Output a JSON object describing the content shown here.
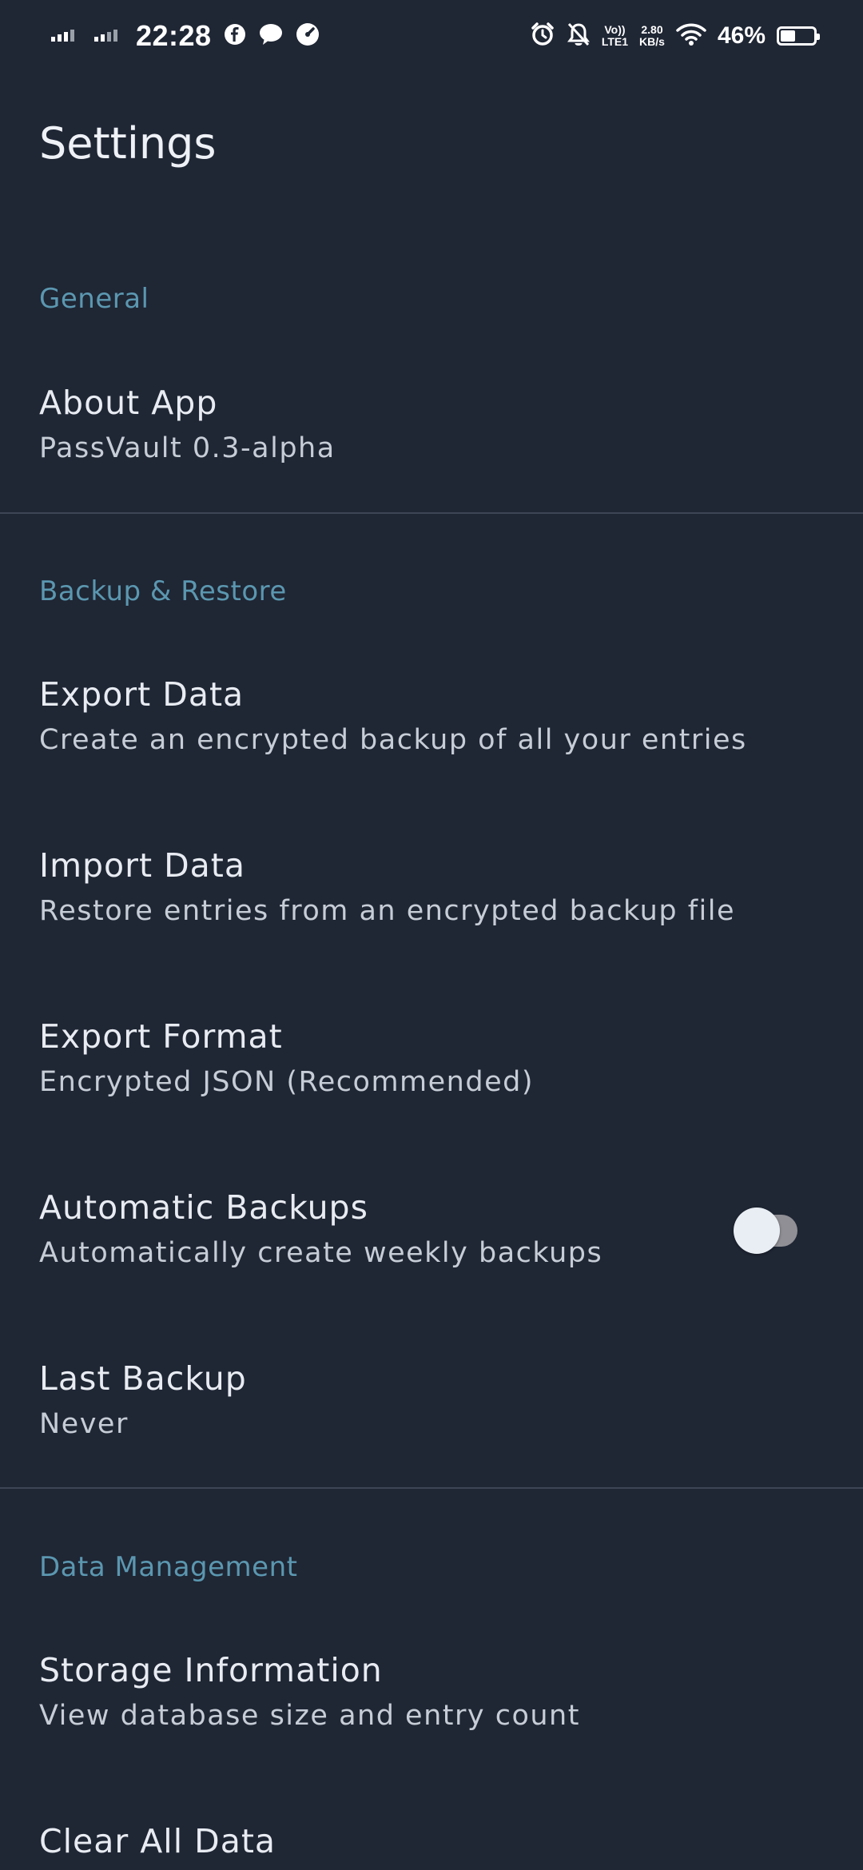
{
  "status_bar": {
    "time": "22:28",
    "net_speed_value": "2.80",
    "net_speed_unit": "KB/s",
    "volte_top": "Vo))",
    "volte_bottom": "LTE1",
    "battery": "46%",
    "battery_level": 0.46,
    "icons": [
      "signal-icon",
      "signal-icon",
      "facebook-icon",
      "messenger-icon",
      "speedometer-icon",
      "alarm-icon",
      "bell-off-icon",
      "wifi-icon",
      "battery-icon"
    ]
  },
  "page": {
    "title": "Settings"
  },
  "sections": {
    "general": {
      "header": "General",
      "about": {
        "title": "About App",
        "subtitle": "PassVault 0.3-alpha"
      }
    },
    "backup": {
      "header": "Backup & Restore",
      "export": {
        "title": "Export Data",
        "subtitle": "Create an encrypted backup of all your entries"
      },
      "import": {
        "title": "Import Data",
        "subtitle": "Restore entries from an encrypted backup file"
      },
      "format": {
        "title": "Export Format",
        "subtitle": "Encrypted JSON (Recommended)"
      },
      "auto": {
        "title": "Automatic Backups",
        "subtitle": "Automatically create weekly backups",
        "enabled": false
      },
      "last": {
        "title": "Last Backup",
        "subtitle": "Never"
      }
    },
    "data": {
      "header": "Data Management",
      "storage": {
        "title": "Storage Information",
        "subtitle": "View database size and entry count"
      },
      "clear": {
        "title": "Clear All Data"
      }
    }
  },
  "colors": {
    "background": "#1f2634",
    "section_header": "#5b97b0",
    "divider": "#3d4655"
  }
}
